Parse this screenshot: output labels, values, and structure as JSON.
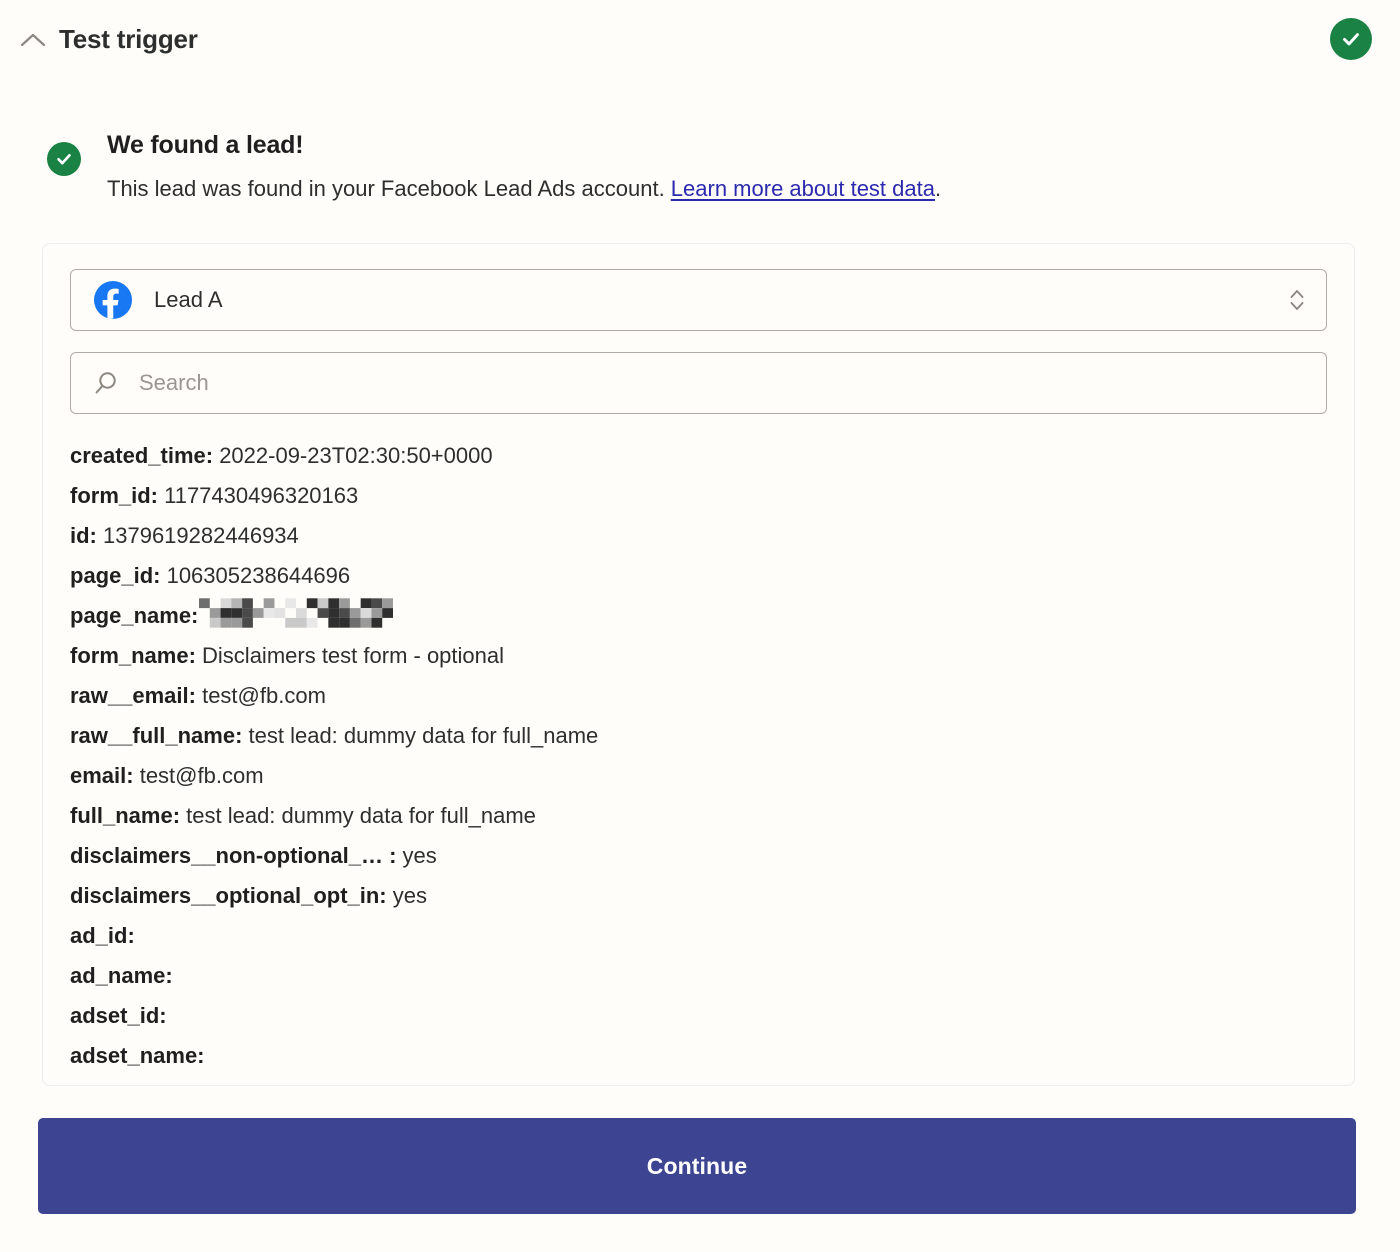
{
  "header": {
    "title": "Test trigger",
    "collapse_icon": "chevron-up-icon",
    "status_icon": "check-circle-icon",
    "status_color": "#1A8245"
  },
  "banner": {
    "icon": "check-circle-icon",
    "title": "We found a lead!",
    "description_before": "This lead was found in your Facebook Lead Ads account. ",
    "link_text": "Learn more about test data",
    "description_after": ".",
    "link_color": "#2B2AAF"
  },
  "record_select": {
    "icon": "facebook-icon",
    "icon_color": "#1877F2",
    "selected_label": "Lead A",
    "caret_icon": "chevron-up-down-icon"
  },
  "search": {
    "icon": "search-icon",
    "placeholder": "Search",
    "value": ""
  },
  "fields": [
    {
      "key": "created_time:",
      "value": "2022-09-23T02:30:50+0000",
      "redacted": false
    },
    {
      "key": "form_id:",
      "value": "1177430496320163",
      "redacted": false
    },
    {
      "key": "id:",
      "value": "1379619282446934",
      "redacted": false
    },
    {
      "key": "page_id:",
      "value": "106305238644696",
      "redacted": false
    },
    {
      "key": "page_name:",
      "value": "",
      "redacted": true
    },
    {
      "key": "form_name:",
      "value": "Disclaimers test form - optional",
      "redacted": false
    },
    {
      "key": "raw__email:",
      "value": "test@fb.com",
      "redacted": false
    },
    {
      "key": "raw__full_name:",
      "value": "test lead: dummy data for full_name",
      "redacted": false
    },
    {
      "key": "email:",
      "value": "test@fb.com",
      "redacted": false
    },
    {
      "key": "full_name:",
      "value": "test lead: dummy data for full_name",
      "redacted": false
    },
    {
      "key": "disclaimers__non-optional_… :",
      "value": "yes",
      "redacted": false
    },
    {
      "key": "disclaimers__optional_opt_in:",
      "value": "yes",
      "redacted": false
    },
    {
      "key": "ad_id:",
      "value": "",
      "redacted": false
    },
    {
      "key": "ad_name:",
      "value": "",
      "redacted": false
    },
    {
      "key": "adset_id:",
      "value": "",
      "redacted": false
    },
    {
      "key": "adset_name:",
      "value": "",
      "redacted": false
    }
  ],
  "continue_button": {
    "label": "Continue",
    "color": "#3D4592"
  }
}
